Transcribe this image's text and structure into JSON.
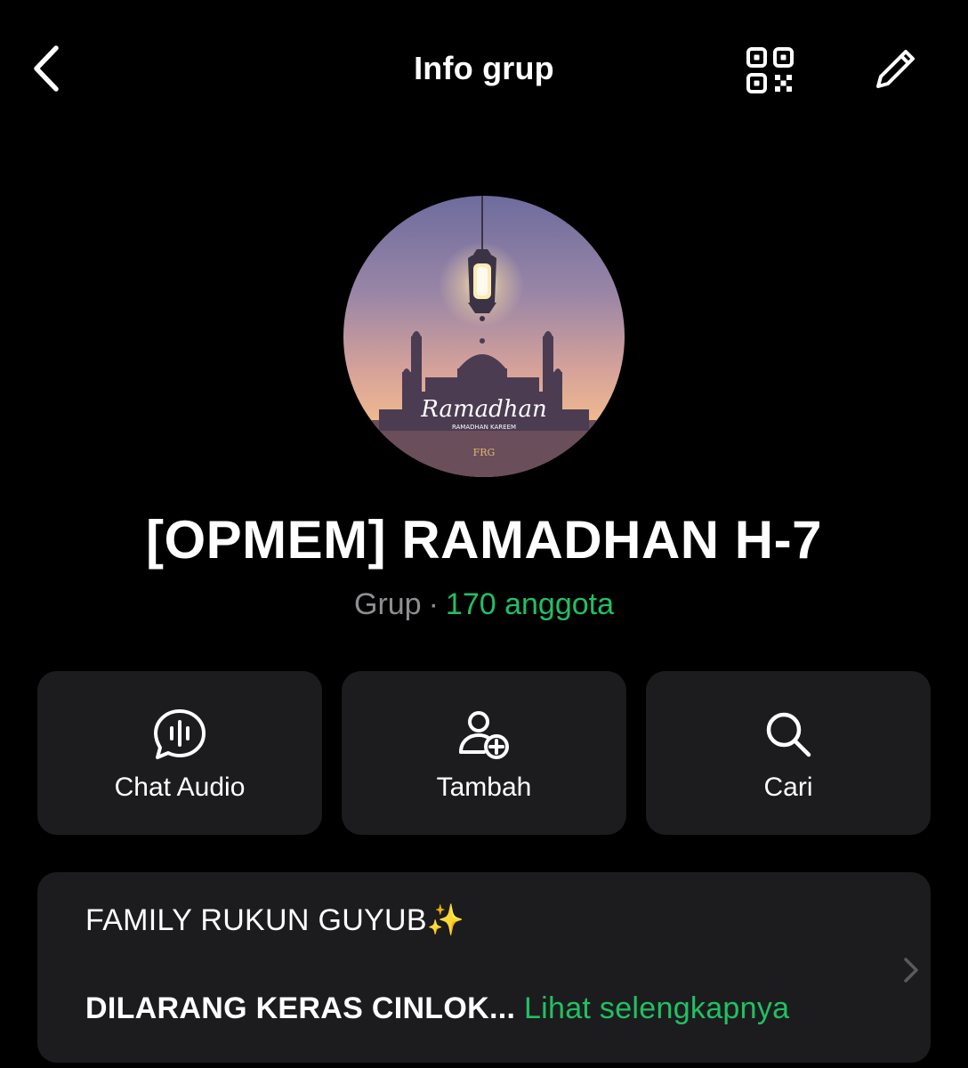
{
  "header": {
    "title": "Info grup",
    "back_icon": "chevron-left-icon",
    "qr_icon": "qr-code-icon",
    "edit_icon": "pencil-icon"
  },
  "group": {
    "avatar": {
      "script_text": "Ramadhan",
      "subtitle": "RAMADHAN KAREEM",
      "monogram": "FRG"
    },
    "name": "[OPMEM] RAMADHAN H-7",
    "type": "Grup",
    "separator": "·",
    "members": "170 anggota"
  },
  "actions": [
    {
      "label": "Chat Audio",
      "icon": "audio-chat-icon"
    },
    {
      "label": "Tambah",
      "icon": "add-person-icon"
    },
    {
      "label": "Cari",
      "icon": "search-icon"
    }
  ],
  "description": {
    "line1": "FAMILY RUKUN GUYUB✨",
    "line2": "DILARANG KERAS CINLOK...",
    "read_more": "Lihat selengkapnya"
  },
  "colors": {
    "background": "#000000",
    "card": "#1c1c1e",
    "accent_green": "#21c063",
    "muted": "#8e8e93"
  }
}
